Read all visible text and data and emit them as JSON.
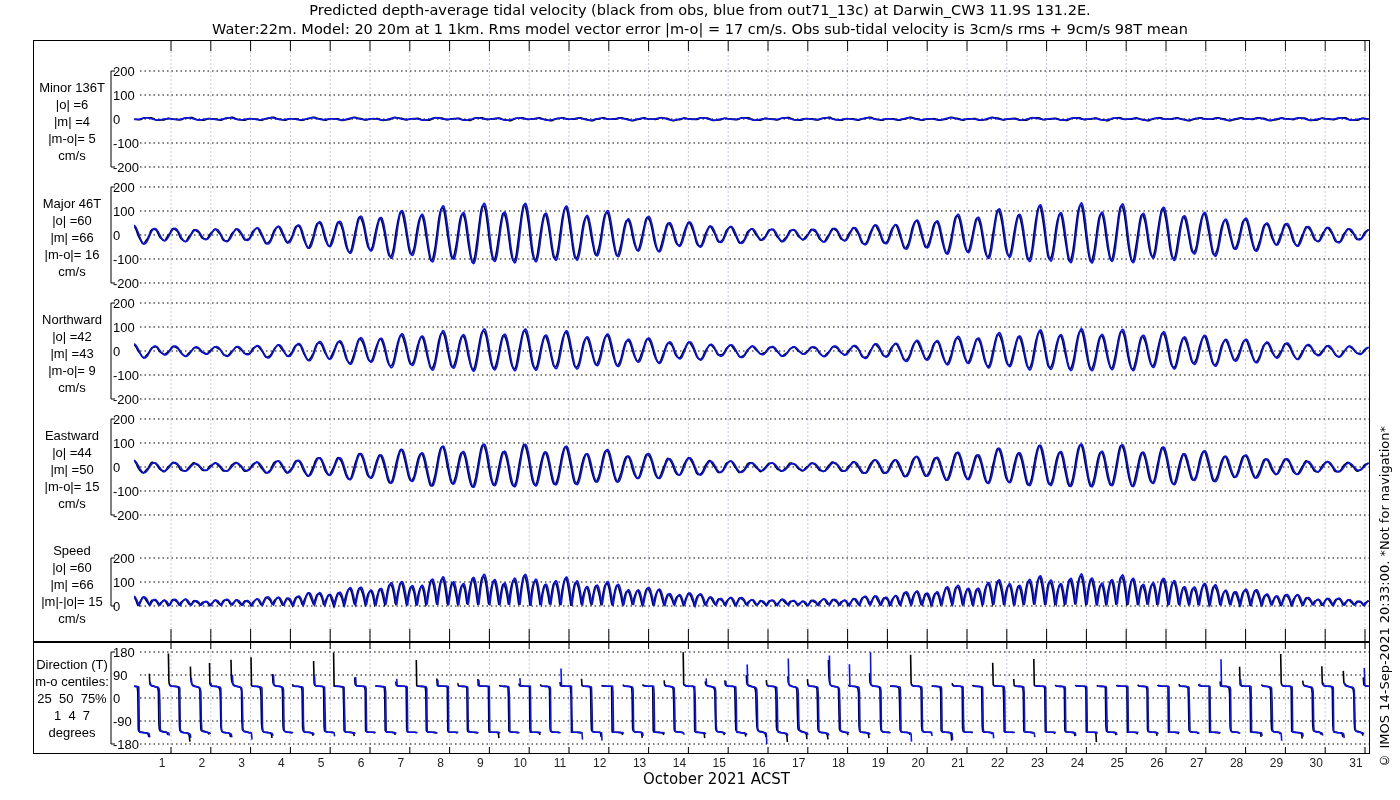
{
  "title_lines": [
    "Predicted depth-average tidal velocity (black from obs, blue from out71_13c) at Darwin_CW3 11.9S 131.2E.",
    "Water:22m. Model: 20 20m at 1 1km. Rms model vector error |m-o| = 17 cm/s. Obs sub-tidal velocity is 3cm/s rms + 9cm/s 98T mean"
  ],
  "panels": [
    {
      "kind": "minor",
      "label_lines": [
        "Minor 136T",
        "|o| =6",
        "|m| =4",
        "|m-o|= 5",
        "cm/s"
      ],
      "yticks": [
        "200",
        "100",
        "0",
        "-100",
        "-200"
      ]
    },
    {
      "kind": "major",
      "label_lines": [
        "Major 46T",
        "|o| =60",
        "|m| =66",
        "|m-o|= 16",
        "cm/s"
      ],
      "yticks": [
        "200",
        "100",
        "0",
        "-100",
        "-200"
      ]
    },
    {
      "kind": "northward",
      "label_lines": [
        "Northward",
        "|o| =42",
        "|m| =43",
        "|m-o|= 9",
        "cm/s"
      ],
      "yticks": [
        "200",
        "100",
        "0",
        "-100",
        "-200"
      ]
    },
    {
      "kind": "eastward",
      "label_lines": [
        "Eastward",
        "|o| =44",
        "|m| =50",
        "|m-o|= 15",
        "cm/s"
      ],
      "yticks": [
        "200",
        "100",
        "0",
        "-100",
        "-200"
      ]
    },
    {
      "kind": "speed",
      "label_lines": [
        "Speed",
        "|o| =60",
        "|m| =66",
        "|m|-|o|= 15",
        "cm/s"
      ],
      "yticks": [
        "200",
        "100",
        "0"
      ]
    },
    {
      "kind": "direction",
      "label_lines": [
        "Direction (T)",
        "m-o centiles:",
        "25  50  75%",
        "1  4  7",
        "degrees"
      ],
      "yticks": [
        "180",
        "90",
        "0",
        "-90",
        "-180"
      ]
    }
  ],
  "x_axis": {
    "ticks": [
      "1",
      "2",
      "3",
      "4",
      "5",
      "6",
      "7",
      "8",
      "9",
      "10",
      "11",
      "12",
      "13",
      "14",
      "15",
      "16",
      "17",
      "18",
      "19",
      "20",
      "21",
      "22",
      "23",
      "24",
      "25",
      "26",
      "27",
      "28",
      "29",
      "30",
      "31"
    ],
    "label": "October 2021 ACST"
  },
  "footer": "© IMOS 14-Sep-2021 20:33:00. *Not for navigation*"
}
